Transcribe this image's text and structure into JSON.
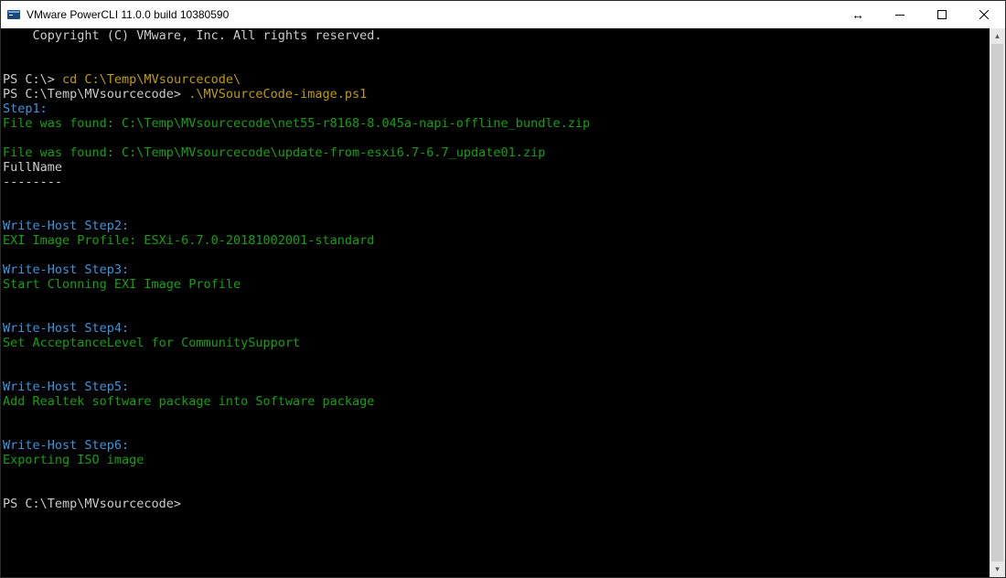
{
  "window": {
    "title": "VMware PowerCLI 11.0.0 build 10380590"
  },
  "terminal": {
    "copyright": "    Copyright (C) VMware, Inc. All rights reserved.",
    "prompt1": "PS C:\\> ",
    "cmd1": "cd C:\\Temp\\MVsourcecode\\",
    "prompt2": "PS C:\\Temp\\MVsourcecode> ",
    "cmd2": ".\\MVSourceCode-image.ps1",
    "step1_label": "Step1:",
    "step1_line1": "File was found: C:\\Temp\\MVsourcecode\\net55-r8168-8.045a-napi-offline_bundle.zip",
    "step1_line2": "File was found: C:\\Temp\\MVsourcecode\\update-from-esxi6.7-6.7_update01.zip",
    "fullname_header": "FullName",
    "fullname_dashes": "--------",
    "step2_label": "Write-Host Step2:",
    "step2_line": "EXI Image Profile: ESXi-6.7.0-20181002001-standard",
    "step3_label": "Write-Host Step3:",
    "step3_line": "Start Clonning EXI Image Profile",
    "step4_label": "Write-Host Step4:",
    "step4_line": "Set AcceptanceLevel for CommunitySupport",
    "step5_label": "Write-Host Step5:",
    "step5_line": "Add Realtek software package into Software package",
    "step6_label": "Write-Host Step6:",
    "step6_line": "Exporting ISO image",
    "prompt_end": "PS C:\\Temp\\MVsourcecode>"
  }
}
